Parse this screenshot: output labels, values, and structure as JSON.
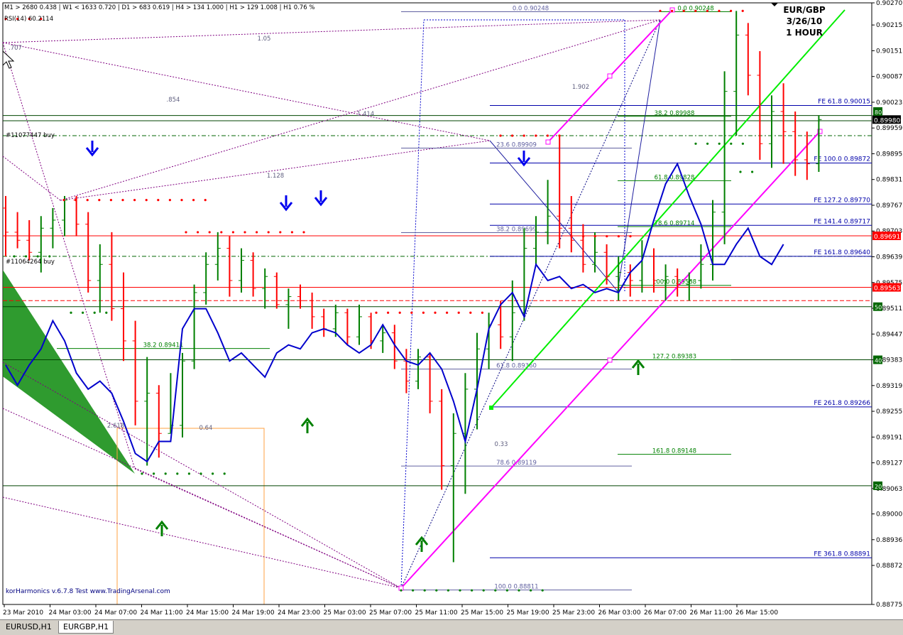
{
  "window": {
    "header_info": "M1 > 2680  0.438  |  W1 < 1633  0.720  |  D1 > 683  0.619  |  H4 > 134  1.000  |  H1 > 129  1.008  |  H1  0.76 %",
    "indicator_label": "RSI(14) 60.2114",
    "symbol": "EUR/GBP",
    "date": "3/26/10",
    "timeframe": "1 HOUR",
    "watermark": "korHarmonics v.6.7.8 Test www.TradingArsenal.com",
    "tabs": [
      "EURUSD,H1",
      "EURGBP,H1"
    ],
    "active_tab": "EURGBP,H1"
  },
  "colors": {
    "bull": "#008000",
    "bear": "#ff0000",
    "rsi": "#0000cc",
    "fib": "#0000aa",
    "magenta": "#ff00ff",
    "lime": "#00ee00",
    "orange": "#ffa040"
  },
  "chart_data": {
    "type": "candlestick",
    "ylim": [
      0.88775,
      0.9027
    ],
    "y_ticks": [
      "0.90270",
      "0.90215",
      "0.90151",
      "0.90087",
      "0.90023",
      "0.89959",
      "0.89895",
      "0.89831",
      "0.89767",
      "0.89703",
      "0.89639",
      "0.89575",
      "0.89511",
      "0.89447",
      "0.89383",
      "0.89319",
      "0.89255",
      "0.89191",
      "0.89127",
      "0.89063",
      "0.89000",
      "0.88936",
      "0.88872",
      "0.88775"
    ],
    "x_ticks": [
      "23 Mar 2010",
      "24 Mar 03:00",
      "24 Mar 07:00",
      "24 Mar 11:00",
      "24 Mar 15:00",
      "24 Mar 19:00",
      "24 Mar 23:00",
      "25 Mar 03:00",
      "25 Mar 07:00",
      "25 Mar 11:00",
      "25 Mar 15:00",
      "25 Mar 19:00",
      "25 Mar 23:00",
      "26 Mar 03:00",
      "26 Mar 07:00",
      "26 Mar 11:00",
      "26 Mar 15:00"
    ],
    "price_tags": [
      {
        "text": "0.89980",
        "value": 0.8998,
        "bg": "#000000"
      },
      {
        "text": "0.89691",
        "value": 0.89691,
        "bg": "#ff0000"
      },
      {
        "text": "0.89563",
        "value": 0.89563,
        "bg": "#ff0000"
      }
    ],
    "level_tags": [
      {
        "text": "80",
        "value": 0.9
      },
      {
        "text": "50",
        "value": 0.89515
      },
      {
        "text": "40",
        "value": 0.89383
      },
      {
        "text": "20",
        "value": 0.8907
      }
    ],
    "ohlc": [
      [
        0.8976,
        0.8979,
        0.8964,
        0.897
      ],
      [
        0.897,
        0.8975,
        0.8966,
        0.8968
      ],
      [
        0.8968,
        0.8973,
        0.8963,
        0.8965
      ],
      [
        0.8965,
        0.8974,
        0.896,
        0.8971
      ],
      [
        0.8971,
        0.8976,
        0.8966,
        0.8973
      ],
      [
        0.8973,
        0.8979,
        0.8969,
        0.8978
      ],
      [
        0.8978,
        0.8979,
        0.8969,
        0.8972
      ],
      [
        0.8972,
        0.8975,
        0.8955,
        0.8958
      ],
      [
        0.8958,
        0.8967,
        0.895,
        0.8962
      ],
      [
        0.8962,
        0.897,
        0.8948,
        0.8951
      ],
      [
        0.8951,
        0.896,
        0.8938,
        0.8943
      ],
      [
        0.8943,
        0.8948,
        0.8922,
        0.8928
      ],
      [
        0.8928,
        0.8939,
        0.8912,
        0.893
      ],
      [
        0.893,
        0.8932,
        0.8914,
        0.892
      ],
      [
        0.892,
        0.8935,
        0.892,
        0.8922
      ],
      [
        0.8922,
        0.894,
        0.8919,
        0.8938
      ],
      [
        0.8938,
        0.8957,
        0.8936,
        0.8955
      ],
      [
        0.8955,
        0.8965,
        0.8952,
        0.8962
      ],
      [
        0.8962,
        0.897,
        0.8958,
        0.8966
      ],
      [
        0.8966,
        0.8969,
        0.8954,
        0.8958
      ],
      [
        0.8958,
        0.8966,
        0.8955,
        0.8963
      ],
      [
        0.8963,
        0.8965,
        0.8954,
        0.8956
      ],
      [
        0.8956,
        0.8961,
        0.8951,
        0.8959
      ],
      [
        0.8959,
        0.896,
        0.8951,
        0.8952
      ],
      [
        0.8952,
        0.8956,
        0.8946,
        0.8954
      ],
      [
        0.8954,
        0.8957,
        0.8951,
        0.8953
      ],
      [
        0.8953,
        0.8955,
        0.8946,
        0.8949
      ],
      [
        0.8949,
        0.8951,
        0.8944,
        0.8946
      ],
      [
        0.8946,
        0.8952,
        0.8944,
        0.895
      ],
      [
        0.895,
        0.8951,
        0.8942,
        0.8944
      ],
      [
        0.8944,
        0.8952,
        0.8942,
        0.8949
      ],
      [
        0.8949,
        0.895,
        0.8941,
        0.8943
      ],
      [
        0.8943,
        0.8947,
        0.894,
        0.8945
      ],
      [
        0.8945,
        0.8947,
        0.8936,
        0.8938
      ],
      [
        0.8938,
        0.8941,
        0.893,
        0.8933
      ],
      [
        0.8933,
        0.8941,
        0.8931,
        0.8939
      ],
      [
        0.8939,
        0.894,
        0.8925,
        0.8928
      ],
      [
        0.8928,
        0.8931,
        0.8906,
        0.8912
      ],
      [
        0.8912,
        0.8925,
        0.8888,
        0.892
      ],
      [
        0.892,
        0.8935,
        0.8905,
        0.8931
      ],
      [
        0.8931,
        0.8945,
        0.8921,
        0.8941
      ],
      [
        0.8941,
        0.895,
        0.8936,
        0.8947
      ],
      [
        0.8947,
        0.8953,
        0.8941,
        0.8944
      ],
      [
        0.8944,
        0.8958,
        0.8938,
        0.895
      ],
      [
        0.895,
        0.8971,
        0.8948,
        0.8966
      ],
      [
        0.8966,
        0.8974,
        0.8962,
        0.897
      ],
      [
        0.897,
        0.8983,
        0.8967,
        0.8974
      ],
      [
        0.8974,
        0.8994,
        0.8966,
        0.8971
      ],
      [
        0.8971,
        0.8979,
        0.8965,
        0.8968
      ],
      [
        0.8968,
        0.8972,
        0.896,
        0.8962
      ],
      [
        0.8962,
        0.897,
        0.896,
        0.8965
      ],
      [
        0.8965,
        0.8967,
        0.8957,
        0.8959
      ],
      [
        0.8959,
        0.8964,
        0.8953,
        0.896
      ],
      [
        0.896,
        0.8962,
        0.8954,
        0.8958
      ],
      [
        0.8958,
        0.8968,
        0.8955,
        0.8964
      ],
      [
        0.8964,
        0.8966,
        0.8955,
        0.8958
      ],
      [
        0.8958,
        0.8962,
        0.8953,
        0.8959
      ],
      [
        0.8959,
        0.8961,
        0.8954,
        0.8957
      ],
      [
        0.8957,
        0.896,
        0.8953,
        0.8958
      ],
      [
        0.8958,
        0.8967,
        0.8956,
        0.8962
      ],
      [
        0.8962,
        0.8978,
        0.8958,
        0.8975
      ],
      [
        0.8975,
        0.901,
        0.8967,
        0.9005
      ],
      [
        0.9005,
        0.9025,
        0.8994,
        0.9019
      ],
      [
        0.9019,
        0.9022,
        0.9004,
        0.9009
      ],
      [
        0.9009,
        0.9015,
        0.8988,
        0.8992
      ],
      [
        0.8992,
        0.9004,
        0.8986,
        0.9
      ],
      [
        0.9,
        0.9007,
        0.8987,
        0.8995
      ],
      [
        0.8995,
        0.9,
        0.8984,
        0.8988
      ],
      [
        0.8988,
        0.8995,
        0.8983,
        0.8987
      ],
      [
        0.8987,
        0.8999,
        0.8985,
        0.8998
      ]
    ],
    "fib_levels": [
      {
        "label": "0.0  0.90248",
        "value": 0.90248,
        "x1": 565,
        "x2": 930,
        "color": "#6060a0"
      },
      {
        "label": "23.6  0.89909",
        "value": 0.89909,
        "x1": 565,
        "x2": 890,
        "color": "#6060a0"
      },
      {
        "label": "38.2  0.89699",
        "value": 0.89699,
        "x1": 565,
        "x2": 890,
        "color": "#6060a0"
      },
      {
        "label": "61.8  0.89360",
        "value": 0.8936,
        "x1": 565,
        "x2": 890,
        "color": "#6060a0"
      },
      {
        "label": "78.6  0.89119",
        "value": 0.89119,
        "x1": 565,
        "x2": 890,
        "color": "#6060a0"
      },
      {
        "label": "100.0  0.88811",
        "value": 0.88811,
        "x1": 565,
        "x2": 890,
        "color": "#6060a0"
      },
      {
        "label": "0.0  0.90248",
        "value": 0.90248,
        "x1": 930,
        "x2": 1030,
        "color": "#008000"
      },
      {
        "label": "38.2  0.89988",
        "value": 0.89988,
        "x1": 870,
        "x2": 1030,
        "color": "#008000"
      },
      {
        "label": "61.8  0.89828",
        "value": 0.89828,
        "x1": 870,
        "x2": 1030,
        "color": "#008000"
      },
      {
        "label": "78.6  0.89714",
        "value": 0.89714,
        "x1": 870,
        "x2": 1030,
        "color": "#008000"
      },
      {
        "label": "100.0  0.89568",
        "value": 0.89568,
        "x1": 870,
        "x2": 1030,
        "color": "#008000"
      },
      {
        "label": "127.2  0.89383",
        "value": 0.89383,
        "x1": 870,
        "x2": 1030,
        "color": "#008000"
      },
      {
        "label": "161.8  0.89148",
        "value": 0.89148,
        "x1": 870,
        "x2": 1030,
        "color": "#008000"
      },
      {
        "label": "38.2  0.89411",
        "value": 0.89411,
        "x1": 80,
        "x2": 380,
        "color": "#008000"
      }
    ],
    "fe_levels": [
      {
        "label": "FE  61.8  0.90015",
        "value": 0.90015
      },
      {
        "label": "FE  100.0  0.89872",
        "value": 0.89872
      },
      {
        "label": "FE  127.2  0.89770",
        "value": 0.8977
      },
      {
        "label": "FE  141.4  0.89717",
        "value": 0.89717
      },
      {
        "label": "FE  161.8  0.89640",
        "value": 0.8964
      },
      {
        "label": "FE  261.8  0.89266",
        "value": 0.89266
      },
      {
        "label": "FE  361.8  0.88891",
        "value": 0.88891
      }
    ],
    "pattern_ratios": [
      "1.05",
      "1.414",
      "1.128",
      "1.902",
      "0.33",
      "2.618",
      "0.64"
    ],
    "ratio_near_cursor": ".707",
    "trade_labels": [
      "#11077447 buy",
      "#11064264 buy"
    ],
    "arrows_down": [
      130,
      403,
      452,
      738
    ],
    "arrows_up": [
      228,
      433,
      594,
      899
    ],
    "rsi_overlay": [
      0.8937,
      0.8932,
      0.8937,
      0.8941,
      0.8948,
      0.8943,
      0.8935,
      0.8931,
      0.8933,
      0.893,
      0.8923,
      0.8915,
      0.8913,
      0.8918,
      0.8918,
      0.8946,
      0.8951,
      0.8951,
      0.8945,
      0.8938,
      0.894,
      0.8937,
      0.8934,
      0.894,
      0.8942,
      0.8941,
      0.8945,
      0.8946,
      0.8945,
      0.8942,
      0.894,
      0.8942,
      0.8947,
      0.8942,
      0.8938,
      0.8937,
      0.894,
      0.8936,
      0.8928,
      0.8918,
      0.8931,
      0.8946,
      0.8952,
      0.8955,
      0.8949,
      0.8962,
      0.8958,
      0.8959,
      0.8956,
      0.8957,
      0.8955,
      0.8956,
      0.8955,
      0.896,
      0.8963,
      0.8973,
      0.8982,
      0.8987,
      0.8979,
      0.8972,
      0.8962,
      0.8962,
      0.8967,
      0.8971,
      0.8964,
      0.8962,
      0.8967
    ]
  }
}
